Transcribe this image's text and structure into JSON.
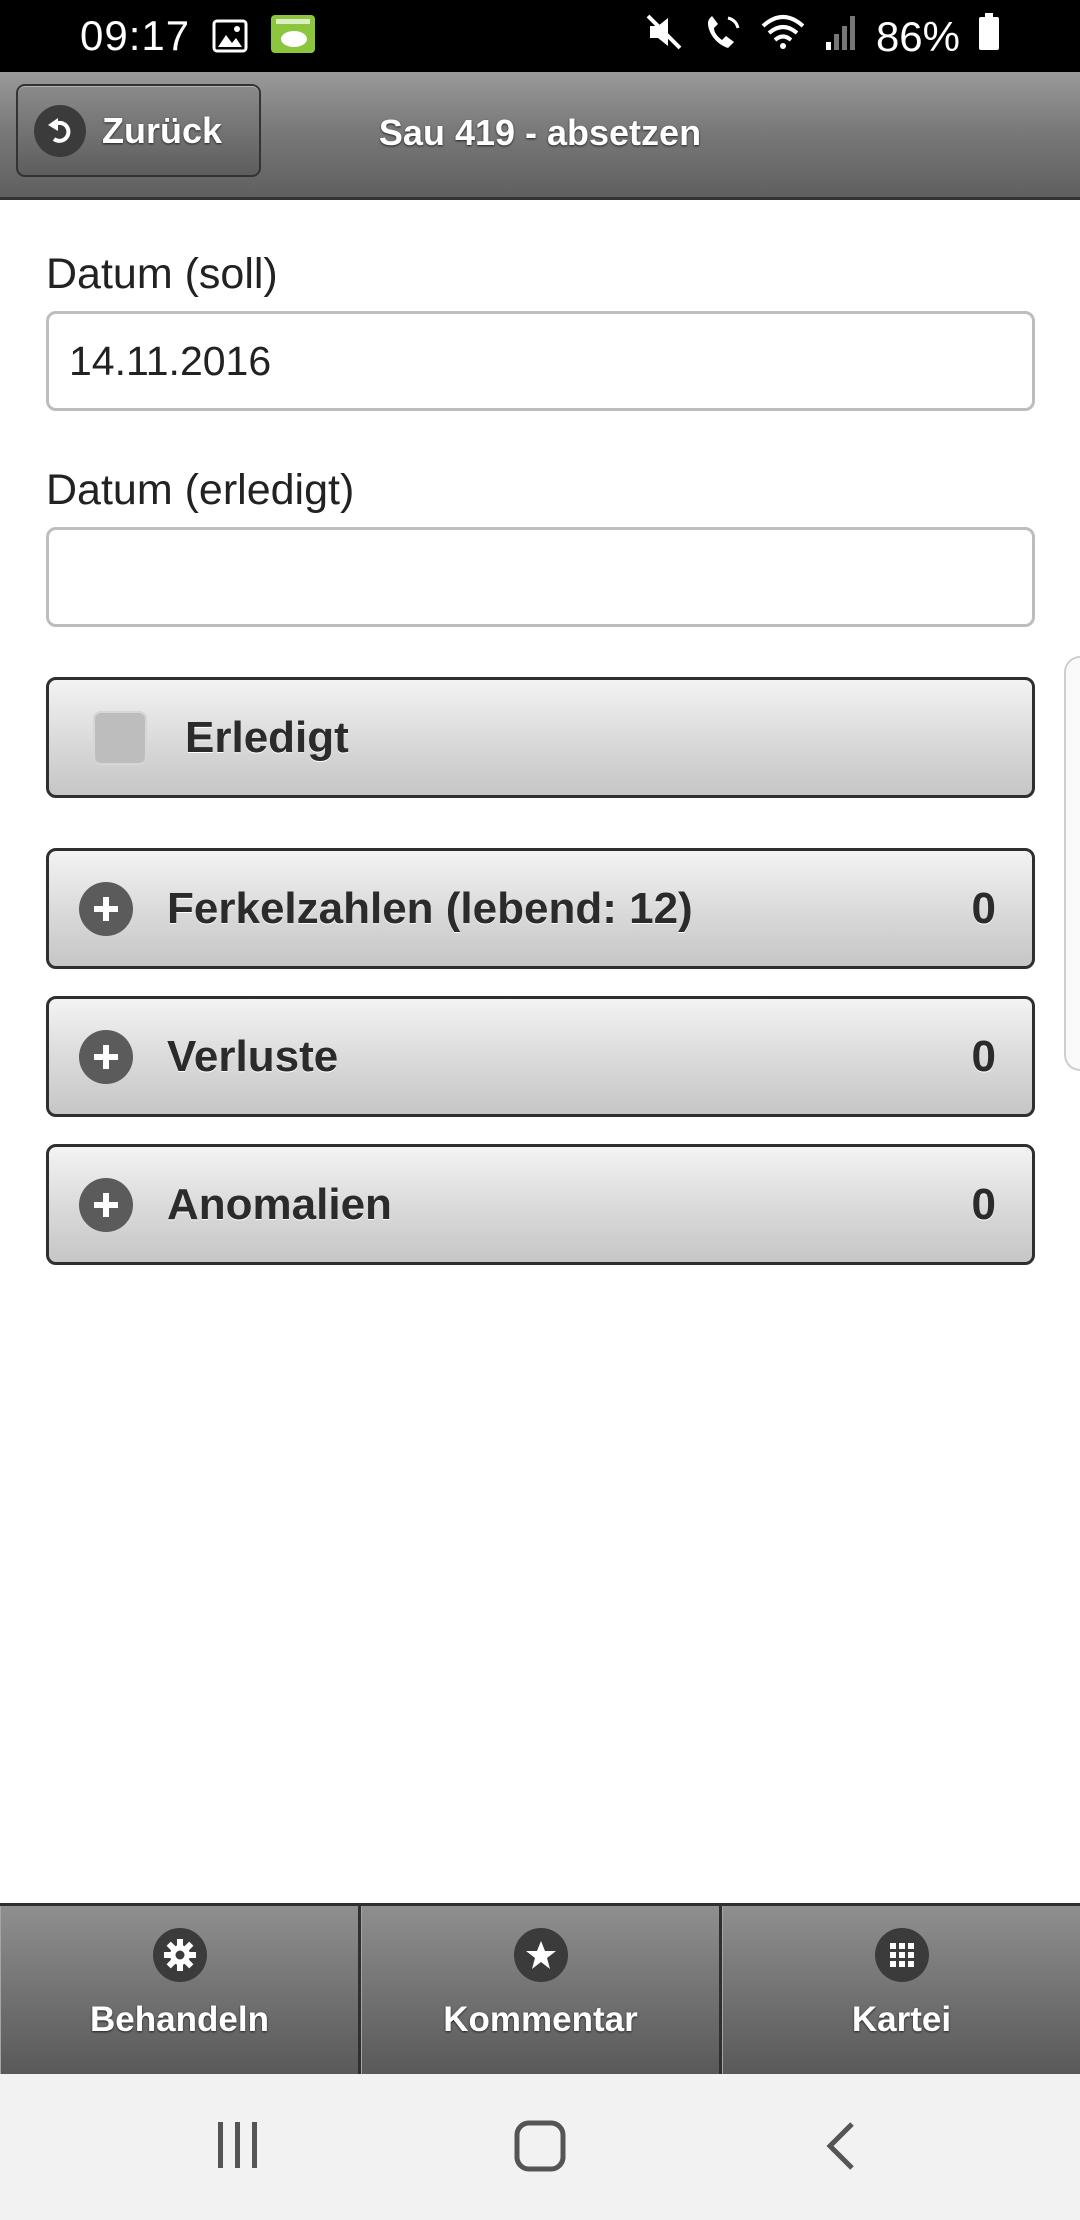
{
  "status_bar": {
    "time": "09:17",
    "battery": "86%",
    "icons_left": [
      "image-icon",
      "app-icon"
    ],
    "icons_right": [
      "mute-icon",
      "wifi-call-icon",
      "wifi-icon",
      "signal-icon",
      "battery-icon"
    ]
  },
  "header": {
    "back_label": "Zurück",
    "title": "Sau 419 - absetzen"
  },
  "form": {
    "date_target_label": "Datum (soll)",
    "date_target_value": "14.11.2016",
    "date_done_label": "Datum (erledigt)",
    "date_done_value": "",
    "done_checkbox_label": "Erledigt",
    "done_checked": false
  },
  "sections": [
    {
      "label": "Ferkelzahlen (lebend: 12)",
      "count": "0"
    },
    {
      "label": "Verluste",
      "count": "0"
    },
    {
      "label": "Anomalien",
      "count": "0"
    }
  ],
  "footer_nav": [
    {
      "label": "Behandeln",
      "icon": "gear-icon"
    },
    {
      "label": "Kommentar",
      "icon": "star-icon"
    },
    {
      "label": "Kartei",
      "icon": "grid-icon"
    }
  ],
  "system_nav": [
    "recent-apps-icon",
    "home-icon",
    "back-icon"
  ],
  "colors": {
    "header_gradient_top": "#9a9a9a",
    "header_gradient_bottom": "#5f5f5f",
    "button_gradient_top": "#f3f3f3",
    "button_gradient_bottom": "#c6c6c6",
    "icon_circle": "#5b5b5b"
  }
}
